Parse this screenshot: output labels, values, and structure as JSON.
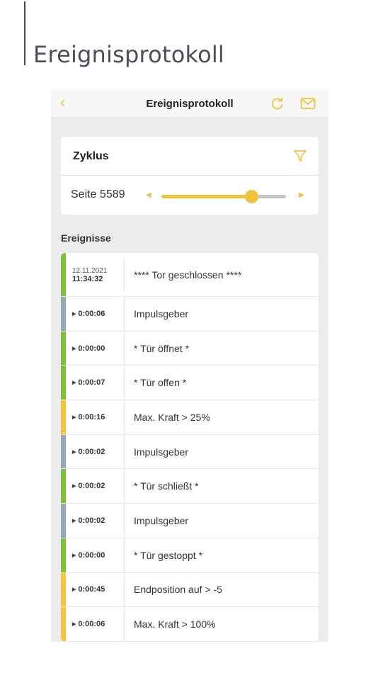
{
  "document": {
    "title": "Ereignisprotokoll"
  },
  "navbar": {
    "title": "Ereignisprotokoll",
    "back_icon": "chevron-left-icon",
    "refresh_icon": "refresh-icon",
    "mail_icon": "mail-icon"
  },
  "filter_card": {
    "title": "Zyklus",
    "filter_icon": "filter-icon",
    "page_label": "Seite 5589",
    "slider_position": 0.72
  },
  "colors": {
    "accent": "#f2c23a",
    "green": "#7cc03c",
    "gray": "#98a7b6",
    "yellow": "#f5c63d"
  },
  "events_header": "Ereignisse",
  "events": [
    {
      "date": "12.11.2021",
      "time": "11:34:32",
      "text": "**** Tor geschlossen ****",
      "status": "green"
    },
    {
      "time": "0:00:06",
      "text": "Impulsgeber",
      "status": "gray"
    },
    {
      "time": "0:00:00",
      "text": "* Tür öffnet *",
      "status": "green"
    },
    {
      "time": "0:00:07",
      "text": "* Tür offen *",
      "status": "green"
    },
    {
      "time": "0:00:16",
      "text": "Max. Kraft > 25%",
      "status": "yellow"
    },
    {
      "time": "0:00:02",
      "text": "Impulsgeber",
      "status": "gray"
    },
    {
      "time": "0:00:02",
      "text": "* Tür schließt *",
      "status": "green"
    },
    {
      "time": "0:00:02",
      "text": "Impulsgeber",
      "status": "gray"
    },
    {
      "time": "0:00:00",
      "text": "* Tür gestoppt *",
      "status": "green"
    },
    {
      "time": "0:00:45",
      "text": "Endposition auf > -5",
      "status": "yellow"
    },
    {
      "time": "0:00:06",
      "text": "Max. Kraft > 100%",
      "status": "yellow"
    }
  ]
}
